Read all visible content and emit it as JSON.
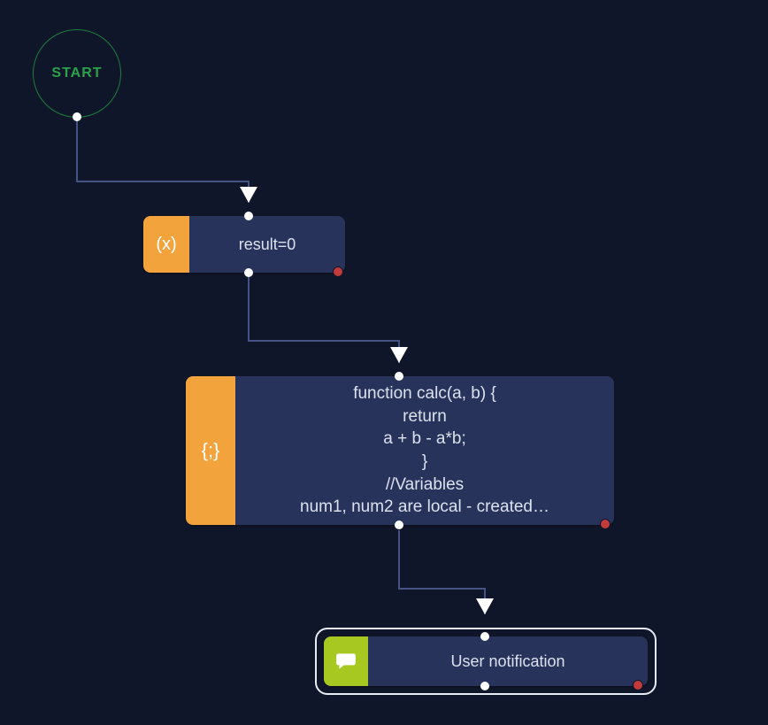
{
  "start": {
    "label": "START"
  },
  "nodes": {
    "var": {
      "icon_name": "variable-icon",
      "icon_glyph": "(x)",
      "icon_color": "#f2a33c",
      "text": "result=0"
    },
    "script": {
      "icon_name": "script-icon",
      "icon_glyph": "{;}",
      "icon_color": "#f2a33c",
      "text": "function calc(a, b) {\nreturn\na + b - a*b;\n}\n//Variables\nnum1, num2 are local - created…"
    },
    "notify": {
      "icon_name": "speech-icon",
      "icon_glyph": "speech",
      "icon_color": "#a6c821",
      "text": "User notification"
    }
  },
  "colors": {
    "bg": "#101629",
    "node_bg": "#27335b",
    "edge": "#445286",
    "start_stroke": "#1b7f3a",
    "start_text": "#2aa24a",
    "port": "#ffffff",
    "breakpoint": "#c23a3a",
    "selection": "#e6ebf5"
  }
}
